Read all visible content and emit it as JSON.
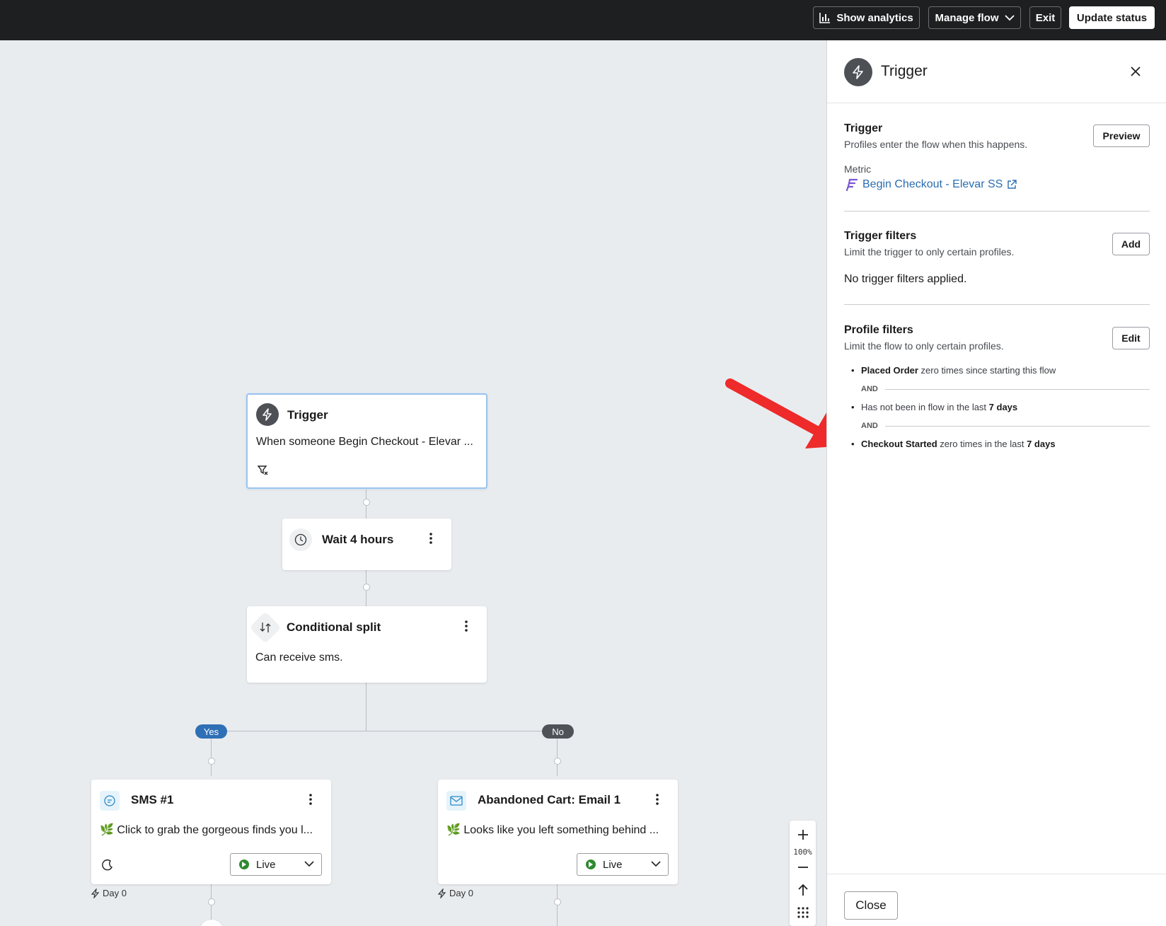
{
  "topbar": {
    "show_analytics": "Show analytics",
    "manage_flow": "Manage flow",
    "exit": "Exit",
    "update_status": "Update status"
  },
  "canvas": {
    "trigger_node": {
      "title": "Trigger",
      "text": "When someone Begin Checkout - Elevar ..."
    },
    "wait_node": {
      "title": "Wait 4 hours"
    },
    "split_node": {
      "title": "Conditional split",
      "text": "Can receive sms."
    },
    "branch_yes": "Yes",
    "branch_no": "No",
    "sms_node": {
      "title": "SMS #1",
      "text": "🌿 Click to grab the gorgeous finds you l...",
      "status": "Live",
      "day": "Day 0"
    },
    "email_node": {
      "title": "Abandoned Cart: Email 1",
      "text": "🌿 Looks like you left something behind ...",
      "status": "Live",
      "day": "Day 0"
    },
    "zoom": {
      "level": "100%"
    },
    "colors": {
      "yes_pill": "#2f6fb5",
      "no_pill": "#4f5257",
      "live": "#2f8a2f",
      "selected_border": "#9cc3ea"
    }
  },
  "panel": {
    "header_title": "Trigger",
    "trigger": {
      "title": "Trigger",
      "subtitle": "Profiles enter the flow when this happens.",
      "button": "Preview",
      "metric_label": "Metric",
      "metric_value": "Begin Checkout - Elevar SS"
    },
    "trigger_filters": {
      "title": "Trigger filters",
      "subtitle": "Limit the trigger to only certain profiles.",
      "button": "Add",
      "empty": "No trigger filters applied."
    },
    "profile_filters": {
      "title": "Profile filters",
      "subtitle": "Limit the flow to only certain profiles.",
      "button": "Edit",
      "and_label": "AND",
      "items": [
        {
          "bold": "Placed Order",
          "rest": " zero times since starting this flow"
        },
        {
          "pre": "Has not been in flow in the last ",
          "bold": "7 days"
        },
        {
          "bold": "Checkout Started",
          "rest": " zero times in the last ",
          "bold2": "7 days"
        }
      ]
    },
    "close_button": "Close"
  }
}
